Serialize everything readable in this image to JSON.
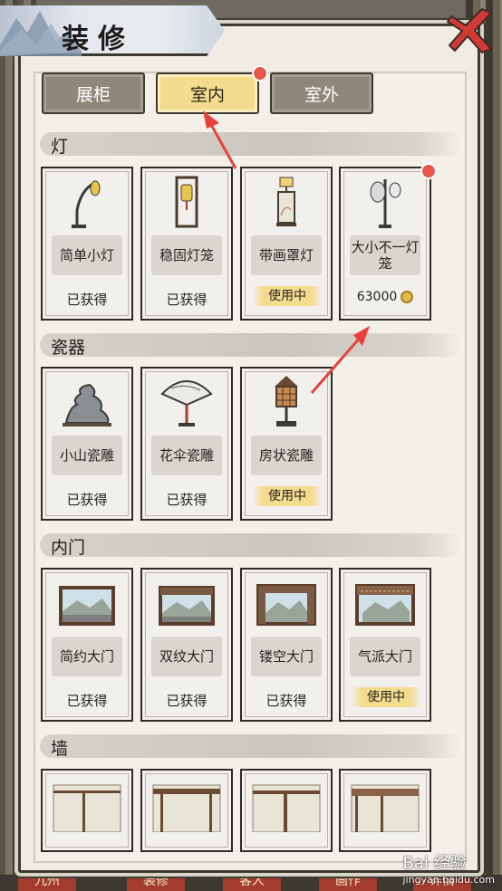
{
  "title": "装修",
  "tabs": [
    {
      "label": "展柜",
      "active": false
    },
    {
      "label": "室内",
      "active": true,
      "badge": true
    },
    {
      "label": "室外",
      "active": false
    }
  ],
  "sections": [
    {
      "label": "灯",
      "items": [
        {
          "name": "简单小灯",
          "status": "已获得"
        },
        {
          "name": "稳固灯笼",
          "status": "已获得"
        },
        {
          "name": "带画罩灯",
          "status": "使用中"
        },
        {
          "name": "大小不一灯笼",
          "price": "63000",
          "badge": true
        }
      ]
    },
    {
      "label": "瓷器",
      "items": [
        {
          "name": "小山瓷雕",
          "status": "已获得"
        },
        {
          "name": "花伞瓷雕",
          "status": "已获得"
        },
        {
          "name": "房状瓷雕",
          "status": "使用中"
        }
      ]
    },
    {
      "label": "内门",
      "items": [
        {
          "name": "简约大门",
          "status": "已获得"
        },
        {
          "name": "双纹大门",
          "status": "已获得"
        },
        {
          "name": "镂空大门",
          "status": "已获得"
        },
        {
          "name": "气派大门",
          "status": "使用中"
        }
      ]
    },
    {
      "label": "墙",
      "items": [
        {
          "name": ""
        },
        {
          "name": ""
        },
        {
          "name": ""
        },
        {
          "name": ""
        }
      ]
    }
  ],
  "bottom_nav": [
    "九州",
    "装修",
    "客人",
    "画作",
    "详情"
  ],
  "watermark": {
    "brand": "Bai 经验",
    "url": "jingyan.baidu.com"
  },
  "colors": {
    "accent_tab": "#f3dc8e",
    "badge": "#e6574c",
    "arrow": "#e8413a"
  }
}
